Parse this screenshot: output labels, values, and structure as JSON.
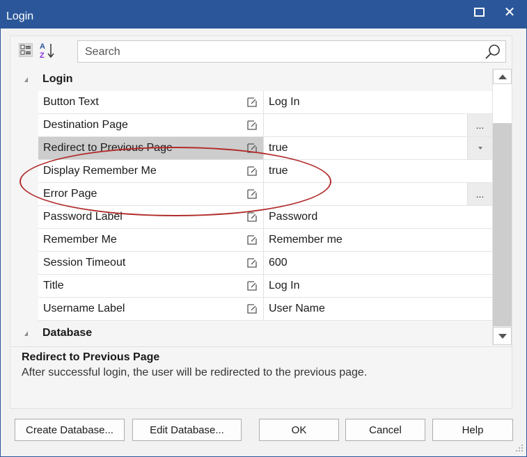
{
  "window": {
    "title": "Login"
  },
  "toolbar": {
    "search_placeholder": "Search"
  },
  "sections": [
    {
      "label": "Login",
      "expanded": true
    },
    {
      "label": "Database",
      "expanded": true
    }
  ],
  "properties": [
    {
      "name": "Button Text",
      "value": "Log In",
      "editor": "none"
    },
    {
      "name": "Destination Page",
      "value": "",
      "editor": "ellipsis",
      "ellipsis_label": "..."
    },
    {
      "name": "Redirect to Previous Page",
      "value": "true",
      "editor": "dropdown",
      "selected": true
    },
    {
      "name": "Display Remember Me",
      "value": "true",
      "editor": "none"
    },
    {
      "name": "Error Page",
      "value": "",
      "editor": "ellipsis",
      "ellipsis_label": "..."
    },
    {
      "name": "Password Label",
      "value": "Password",
      "editor": "none"
    },
    {
      "name": "Remember Me",
      "value": "Remember me",
      "editor": "none"
    },
    {
      "name": "Session Timeout",
      "value": "600",
      "editor": "none"
    },
    {
      "name": "Title",
      "value": "Log In",
      "editor": "none"
    },
    {
      "name": "Username Label",
      "value": "User Name",
      "editor": "none"
    }
  ],
  "description": {
    "title": "Redirect to Previous Page",
    "text": "After successful login, the user will be redirected to the previous page."
  },
  "buttons": {
    "create_database": "Create Database...",
    "edit_database": "Edit Database...",
    "ok": "OK",
    "cancel": "Cancel",
    "help": "Help"
  },
  "colors": {
    "titlebar": "#2b579a",
    "highlight_oval": "#b22c2c",
    "selected_row": "#cdcdcd"
  }
}
